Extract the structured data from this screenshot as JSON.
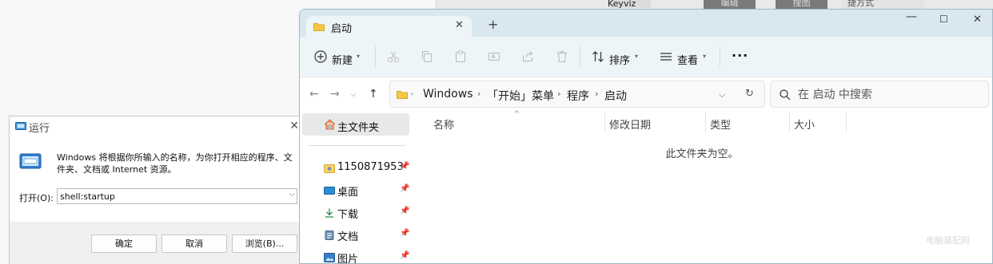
{
  "background": {
    "keyviz_label": "Keyviz",
    "edit_label": "编辑",
    "search_label": "搜图",
    "shortcut_label": "捷方式"
  },
  "run_dialog": {
    "title": "运行",
    "description": "Windows 将根据你所输入的名称，为你打开相应的程序、文件夹、文档或 Internet 资源。",
    "open_label": "打开(O):",
    "input_value": "shell:startup",
    "ok_label": "确定",
    "cancel_label": "取消",
    "browse_label": "浏览(B)..."
  },
  "explorer": {
    "tab_title": "启动",
    "toolbar": {
      "new_label": "新建",
      "sort_label": "排序",
      "view_label": "查看",
      "more_label": "···"
    },
    "breadcrumb": [
      "Windows",
      "「开始」菜单",
      "程序",
      "启动"
    ],
    "search_placeholder": "在 启动 中搜索",
    "nav": {
      "home_label": "主文件夹",
      "items": [
        {
          "label": "1150871953",
          "icon": "user-folder-icon"
        },
        {
          "label": "桌面",
          "icon": "desktop-icon"
        },
        {
          "label": "下载",
          "icon": "download-icon"
        },
        {
          "label": "文档",
          "icon": "documents-icon"
        },
        {
          "label": "图片",
          "icon": "pictures-icon"
        }
      ]
    },
    "columns": [
      "名称",
      "修改日期",
      "类型",
      "大小"
    ],
    "empty_message": "此文件夹为空。"
  },
  "watermark": "电脑装配网"
}
